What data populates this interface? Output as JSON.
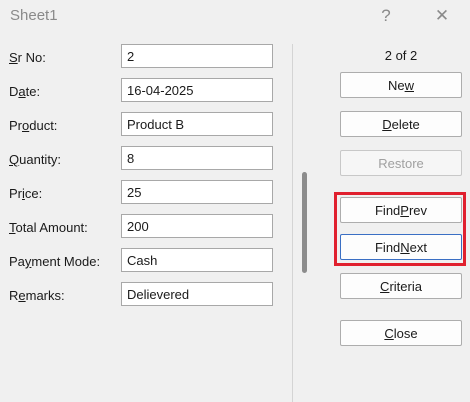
{
  "window": {
    "title": "Sheet1",
    "help_glyph": "?",
    "close_glyph": "✕"
  },
  "form": {
    "fields": [
      {
        "label_pre": "",
        "label_key": "S",
        "label_post": "r No:",
        "value": "2"
      },
      {
        "label_pre": "D",
        "label_key": "a",
        "label_post": "te:",
        "value": "16-04-2025"
      },
      {
        "label_pre": "Pr",
        "label_key": "o",
        "label_post": "duct:",
        "value": "Product B"
      },
      {
        "label_pre": "",
        "label_key": "Q",
        "label_post": "uantity:",
        "value": "8"
      },
      {
        "label_pre": "Pr",
        "label_key": "i",
        "label_post": "ce:",
        "value": "25"
      },
      {
        "label_pre": "",
        "label_key": "T",
        "label_post": "otal Amount:",
        "value": "200"
      },
      {
        "label_pre": "Pa",
        "label_key": "y",
        "label_post": "ment Mode:",
        "value": "Cash"
      },
      {
        "label_pre": "R",
        "label_key": "e",
        "label_post": "marks:",
        "value": "Delievered"
      }
    ]
  },
  "record_counter": "2 of 2",
  "buttons": {
    "new": {
      "pre": "Ne",
      "key": "w",
      "post": ""
    },
    "delete": {
      "pre": "",
      "key": "D",
      "post": "elete"
    },
    "restore": {
      "pre": "",
      "key": "",
      "post": "Restore"
    },
    "find_prev": {
      "pre": "Find ",
      "key": "P",
      "post": "rev"
    },
    "find_next": {
      "pre": "Find ",
      "key": "N",
      "post": "ext"
    },
    "criteria": {
      "pre": "",
      "key": "C",
      "post": "riteria"
    },
    "close": {
      "pre": "",
      "key": "C",
      "post": "lose"
    }
  },
  "colors": {
    "highlight_border": "#e0202e",
    "focus_border": "#3a6fc4"
  }
}
